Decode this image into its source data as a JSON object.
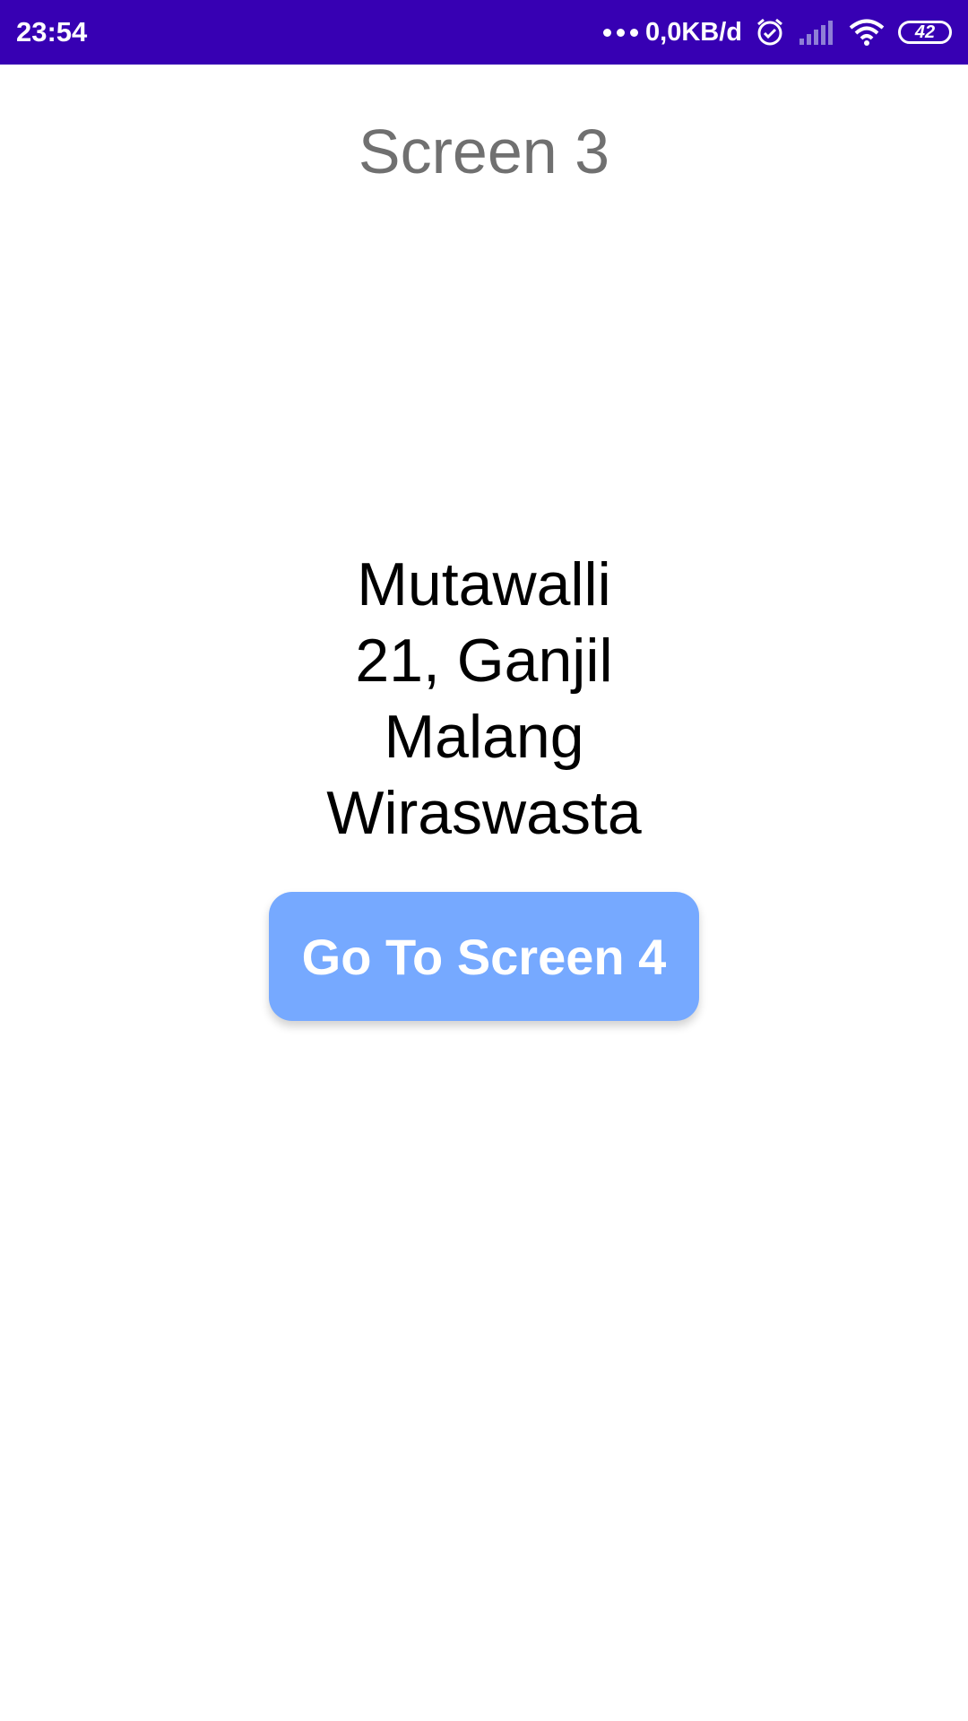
{
  "status_bar": {
    "time": "23:54",
    "net_speed": "0,0KB/d",
    "battery": "42",
    "icons": [
      "more-dots-icon",
      "alarm-icon",
      "signal-icon",
      "wifi-icon",
      "battery-icon"
    ],
    "background": "#3700b3"
  },
  "screen": {
    "title": "Screen 3",
    "info": {
      "name": "Mutawalli",
      "age_class": "21, Ganjil",
      "city": "Malang",
      "job": "Wiraswasta"
    },
    "button_label": "Go To Screen 4",
    "button_color": "#76a9ff"
  }
}
